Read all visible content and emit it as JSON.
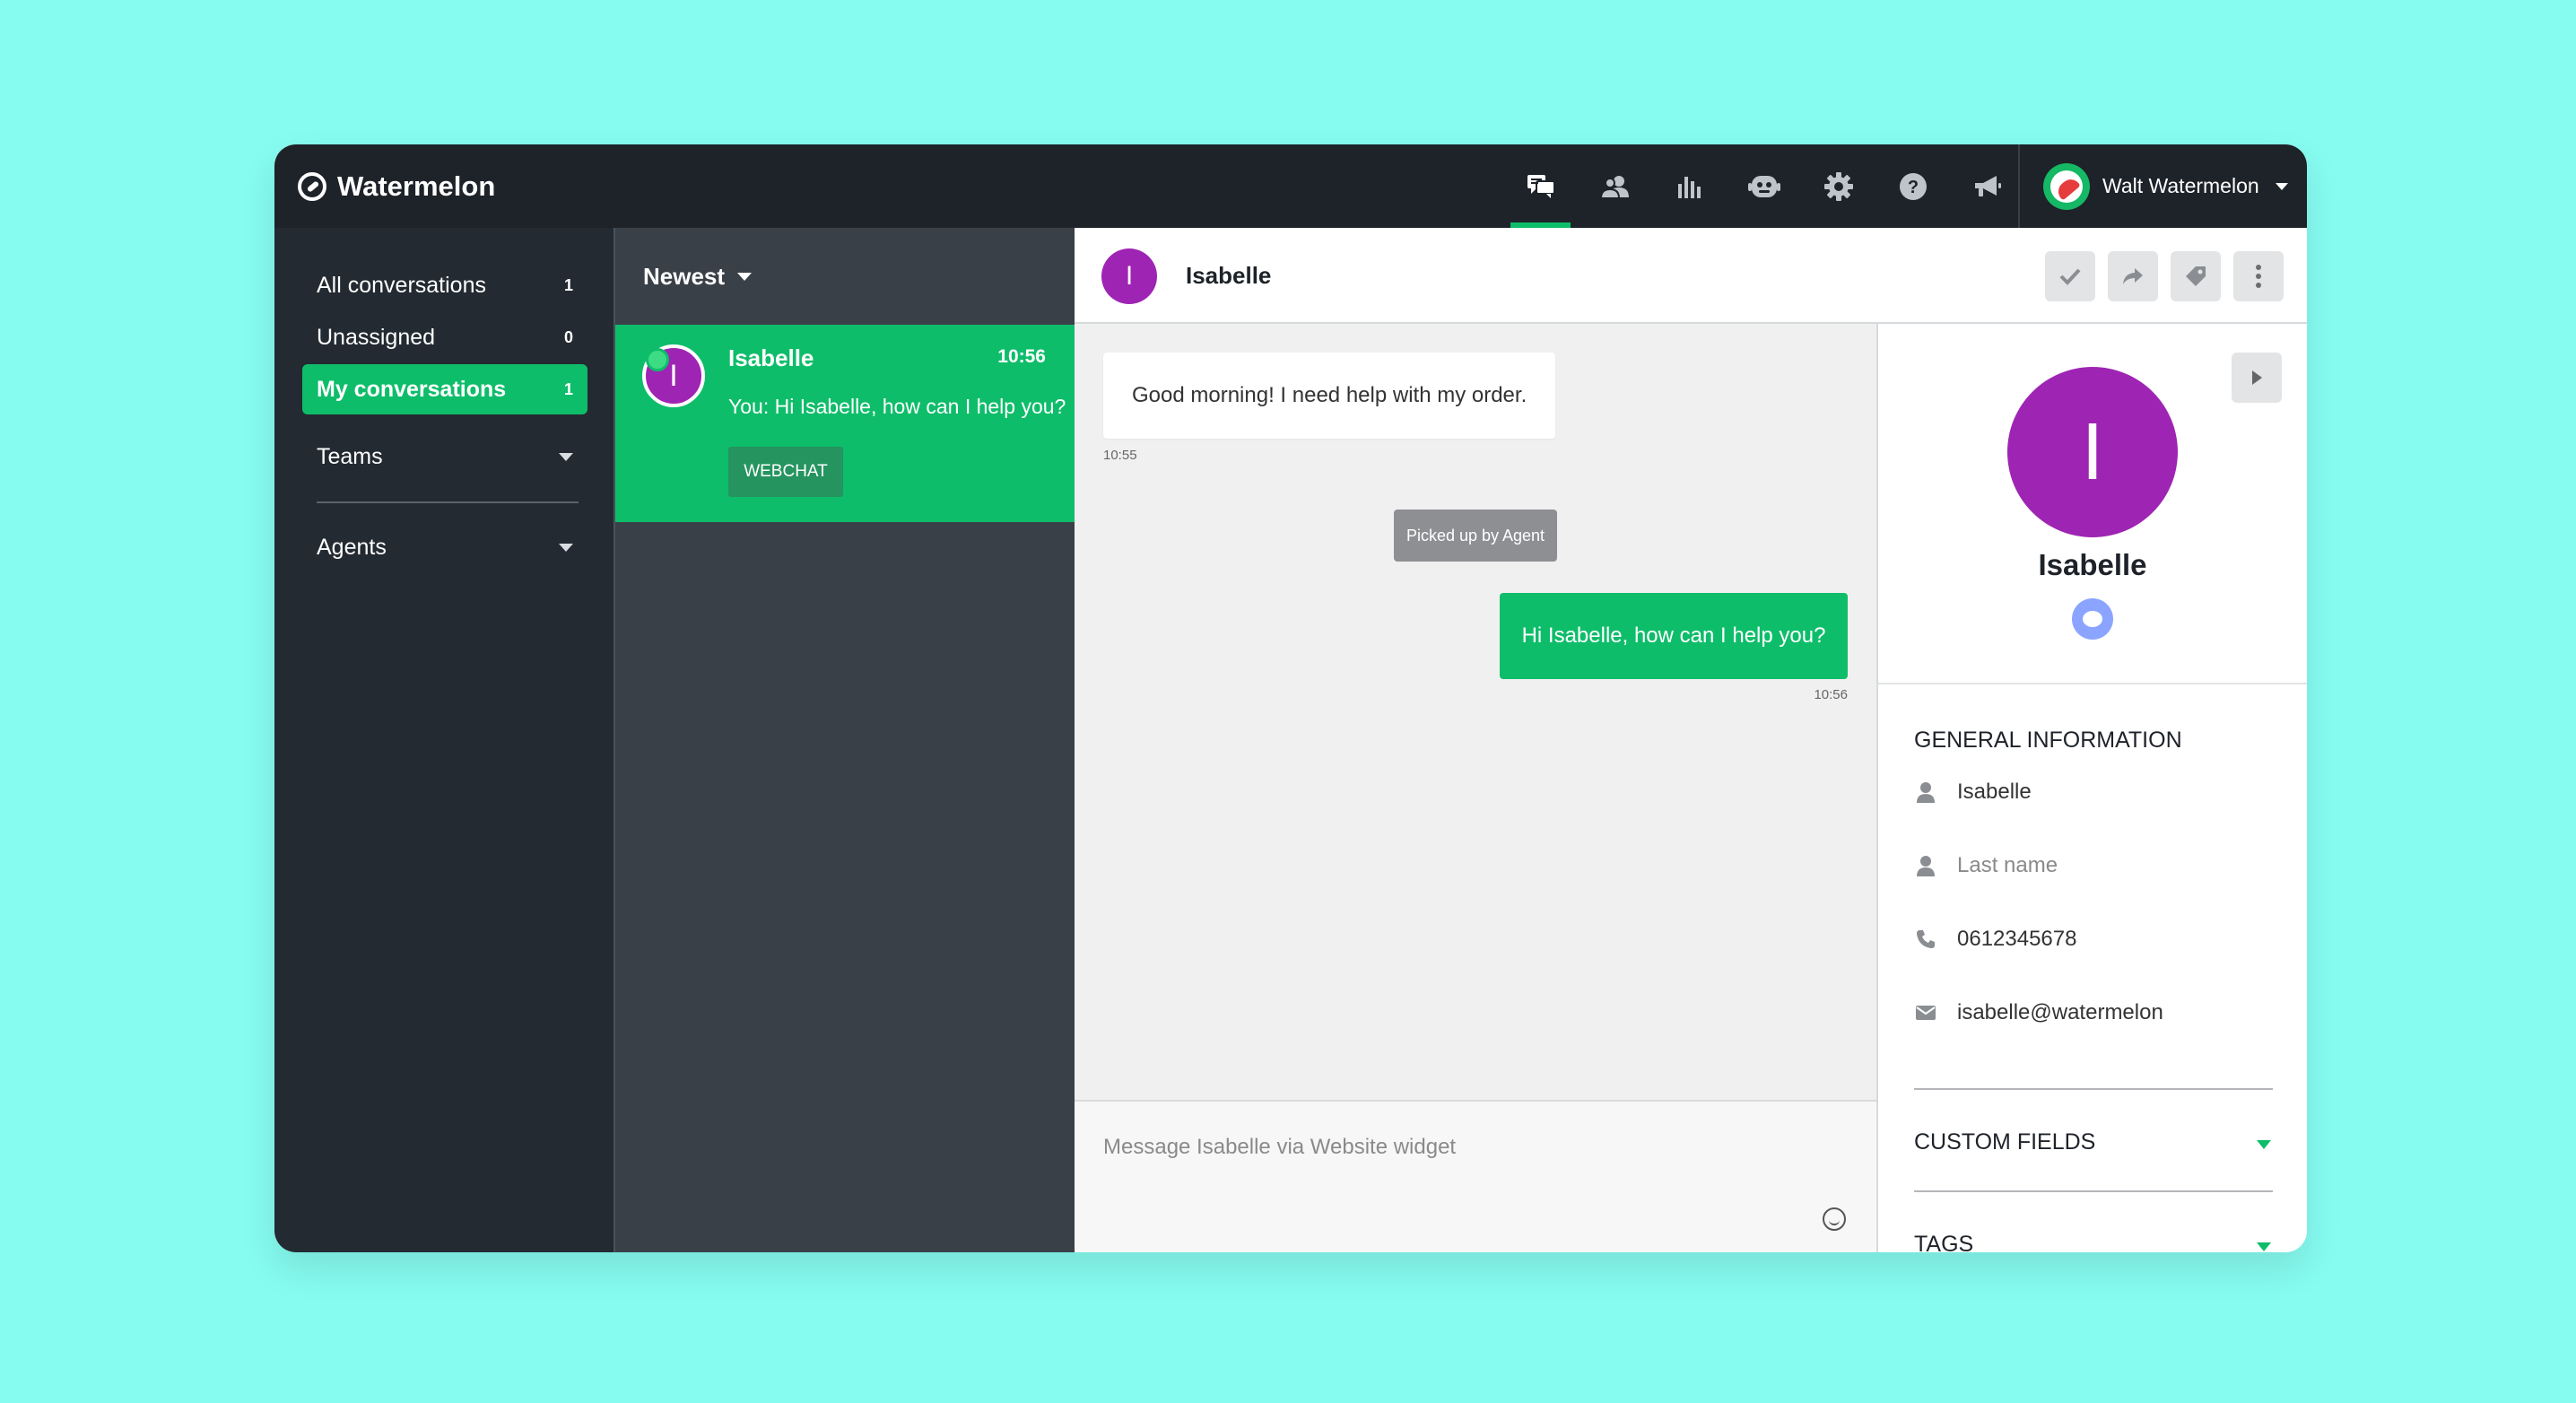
{
  "app": {
    "name": "Watermelon"
  },
  "nav": {
    "icons": [
      "conversations-icon",
      "contacts-icon",
      "reports-icon",
      "bot-icon",
      "settings-icon",
      "help-icon",
      "announcements-icon"
    ],
    "active": "conversations-icon"
  },
  "user": {
    "name": "Walt Watermelon"
  },
  "sidebar": {
    "all": {
      "label": "All conversations",
      "count": "1"
    },
    "unassigned": {
      "label": "Unassigned",
      "count": "0"
    },
    "mine": {
      "label": "My conversations",
      "count": "1"
    },
    "teams": {
      "label": "Teams"
    },
    "agents": {
      "label": "Agents"
    }
  },
  "list": {
    "sort_label": "Newest",
    "conversations": [
      {
        "avatar_letter": "I",
        "name": "Isabelle",
        "time": "10:56",
        "preview": "You: Hi Isabelle, how can I help you?",
        "channel": "WEBCHAT"
      }
    ]
  },
  "chat": {
    "avatar_letter": "I",
    "name": "Isabelle",
    "messages": {
      "incoming": {
        "text": "Good morning! I need help with my order.",
        "time": "10:55"
      },
      "system": {
        "text": "Picked up by Agent"
      },
      "outgoing": {
        "text": "Hi Isabelle, how can I help you?",
        "time": "10:56"
      }
    },
    "composer_placeholder": "Message Isabelle via Website widget"
  },
  "profile": {
    "avatar_letter": "I",
    "name": "Isabelle",
    "general_title": "GENERAL INFORMATION",
    "first_name": "Isabelle",
    "last_name_placeholder": "Last name",
    "phone": "0612345678",
    "email": "isabelle@watermelon",
    "custom_fields_title": "CUSTOM FIELDS",
    "tags_title": "TAGS"
  },
  "colors": {
    "accent": "#0ebd6a",
    "topbar": "#1e2229",
    "sidebar": "#232a31",
    "list_bg": "#3a4048",
    "avatar": "#9e24b3",
    "page_bg": "#86fbf0"
  }
}
